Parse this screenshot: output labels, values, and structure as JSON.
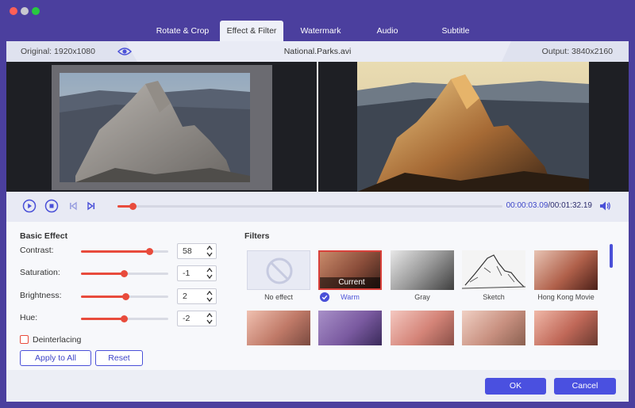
{
  "tabs": [
    {
      "label": "Rotate & Crop"
    },
    {
      "label": "Effect & Filter"
    },
    {
      "label": "Watermark"
    },
    {
      "label": "Audio"
    },
    {
      "label": "Subtitle"
    }
  ],
  "active_tab": "Effect & Filter",
  "infobar": {
    "original": "Original: 1920x1080",
    "file_name": "National.Parks.avi",
    "output": "Output: 3840x2160"
  },
  "playback": {
    "time_current": "00:00:03.09",
    "time_total": "/00:01:32.19",
    "progress": 0.04
  },
  "basic_effect": {
    "title": "Basic Effect",
    "controls": [
      {
        "label": "Contrast:",
        "value": "58",
        "level": 0.78
      },
      {
        "label": "Saturation:",
        "value": "-1",
        "level": 0.49
      },
      {
        "label": "Brightness:",
        "value": "2",
        "level": 0.51
      },
      {
        "label": "Hue:",
        "value": "-2",
        "level": 0.49
      }
    ],
    "deinterlacing_label": "Deinterlacing",
    "deinterlacing_checked": false,
    "apply_all_label": "Apply to All",
    "reset_label": "Reset"
  },
  "filters": {
    "title": "Filters",
    "current_badge": "Current",
    "selected": "Warm",
    "items": [
      {
        "label": "No effect"
      },
      {
        "label": "Warm"
      },
      {
        "label": "Gray"
      },
      {
        "label": "Sketch"
      },
      {
        "label": "Hong Kong Movie"
      }
    ]
  },
  "footer": {
    "ok_label": "OK",
    "cancel_label": "Cancel"
  },
  "colors": {
    "accent": "#4a50e0",
    "slider": "#e84b3c",
    "titlebar": "#4b3f9e"
  }
}
